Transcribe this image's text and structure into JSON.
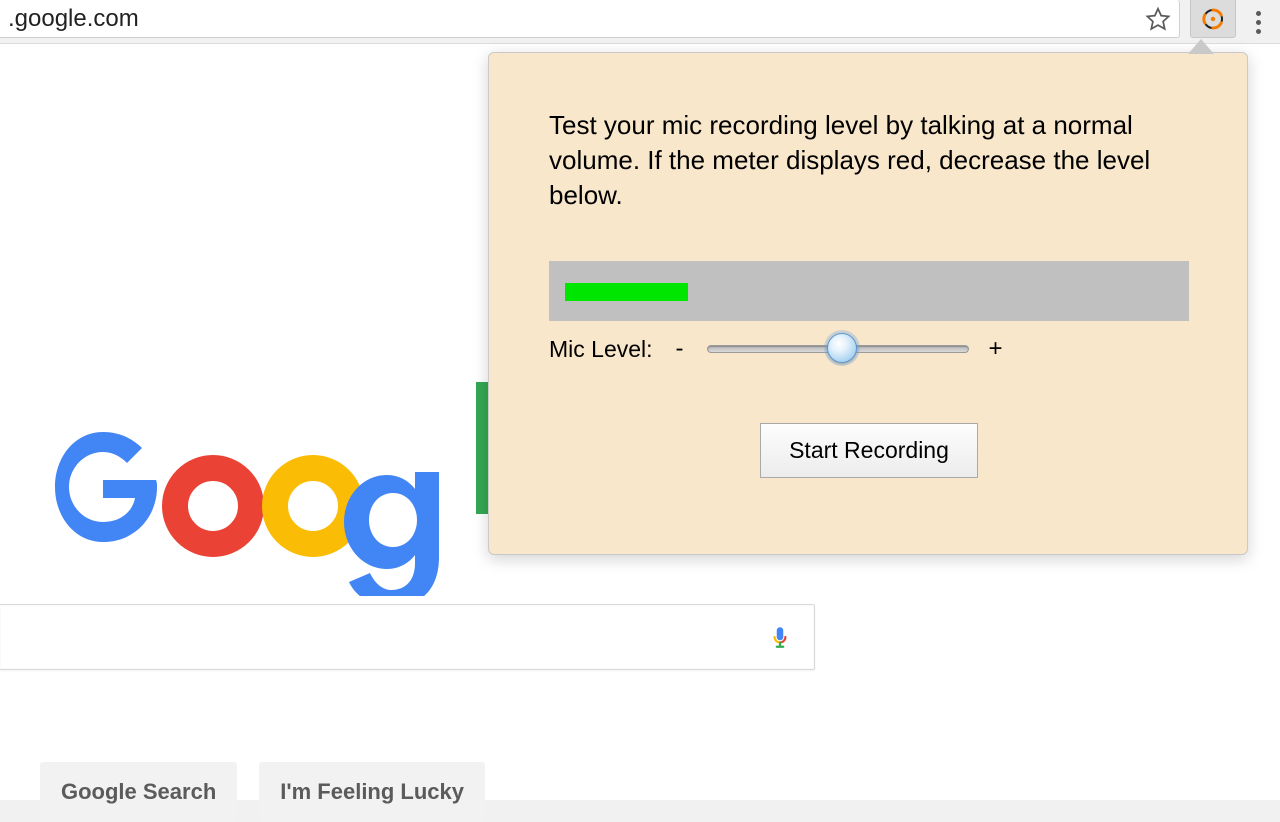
{
  "chrome": {
    "url_visible": ".google.com"
  },
  "page": {
    "search_placeholder": "",
    "buttons": {
      "search_label": "Google Search",
      "lucky_label": "I'm Feeling Lucky"
    }
  },
  "popup": {
    "instructions": "Test your mic recording level by talking at a normal volume. If the meter displays red, decrease the level below.",
    "mic_level_label": "Mic Level:",
    "minus_label": "-",
    "plus_label": "+",
    "start_button_label": "Start Recording",
    "meter_fill_percent": 19,
    "slider_position_percent": 48
  }
}
